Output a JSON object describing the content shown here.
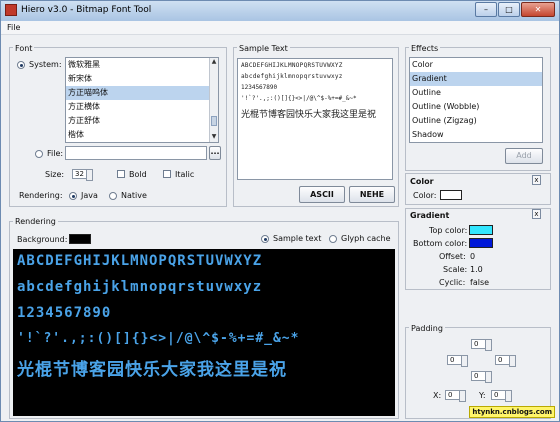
{
  "window": {
    "title": "Hiero v3.0 - Bitmap Font Tool",
    "min": "–",
    "max": "□",
    "close": "✕"
  },
  "menu": {
    "file": "File"
  },
  "font": {
    "header": "Font",
    "system_label": "System:",
    "system_list": [
      "微软雅黑",
      "新宋体",
      "方正喵呜体",
      "方正横体",
      "方正舒体",
      "楷体"
    ],
    "selected": "方正喵呜体",
    "file_label": "File:",
    "file_value": "",
    "browse": "...",
    "size_label": "Size:",
    "size_value": "32",
    "bold": "Bold",
    "italic": "Italic",
    "rendering_label": "Rendering:",
    "java": "Java",
    "native": "Native"
  },
  "sample_text": {
    "header": "Sample Text",
    "lines": [
      "ABCDEFGHIJKLMNOPQRSTUVWXYZ",
      "abcdefghijklmnopqrstuvwxyz",
      "1234567890",
      "'!`?'.,;:()[]{}<>|/@\\^$-%+=#_&~*",
      "光棍节博客园快乐大家我这里是祝"
    ],
    "ascii": "ASCII",
    "nehe": "NEHE"
  },
  "effects": {
    "header": "Effects",
    "items": [
      "Color",
      "Gradient",
      "Outline",
      "Outline (Wobble)",
      "Outline (Zigzag)",
      "Shadow"
    ],
    "selected": "Gradient",
    "add": "Add"
  },
  "color_effect": {
    "header": "Color",
    "label": "Color:",
    "value": "#ffffff",
    "close": "x"
  },
  "gradient_effect": {
    "header": "Gradient",
    "close": "x",
    "top_label": "Top color:",
    "top_color": "#33e6ff",
    "bottom_label": "Bottom color:",
    "bottom_color": "#0018d8",
    "offset_label": "Offset:",
    "offset_value": "0",
    "scale_label": "Scale:",
    "scale_value": "1.0",
    "cyclic_label": "Cyclic:",
    "cyclic_value": "false"
  },
  "rendering": {
    "header": "Rendering",
    "background_label": "Background:",
    "background_color": "#000000",
    "sample_text": "Sample text",
    "glyph_cache": "Glyph cache",
    "preview_lines": [
      "ABCDEFGHIJKLMNOPQRSTUVWXYZ",
      "abcdefghijklmnopqrstuvwxyz",
      "1234567890",
      "'!`?'.,;:()[]{}<>|/@\\^$-%+=#_&~*",
      "光棍节博客园快乐大家我这里是祝"
    ]
  },
  "padding": {
    "header": "Padding",
    "top": "0",
    "left": "0",
    "right": "0",
    "bottom": "0",
    "x_label": "X:",
    "x_value": "0",
    "y_label": "Y:",
    "y_value": "0"
  },
  "watermark": "htynkn.cnblogs.com"
}
